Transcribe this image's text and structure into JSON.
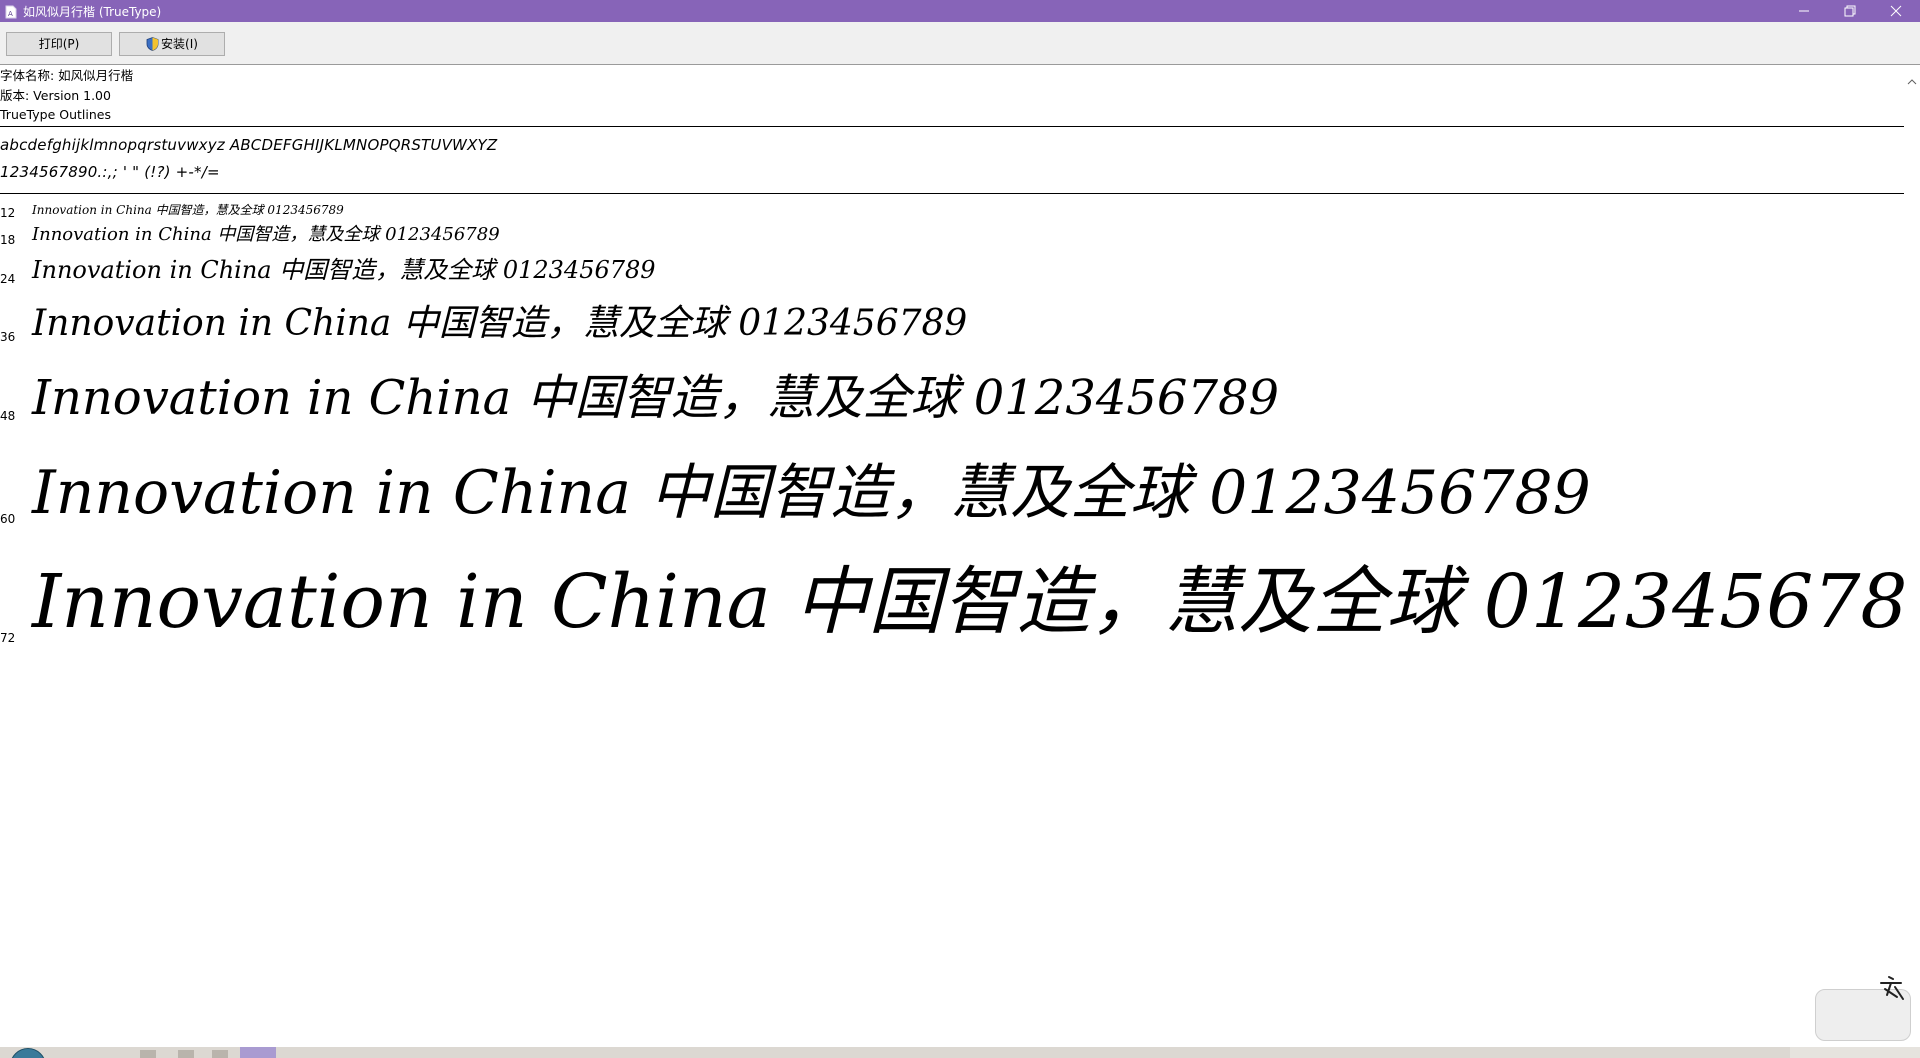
{
  "window": {
    "title": "如风似月行楷 (TrueType)",
    "colors": {
      "titlebar": "#8764b8",
      "title_text": "#ffffff"
    }
  },
  "titlebar": {
    "icons": [
      "font-file-icon",
      "minimize-icon",
      "maximize-icon",
      "close-icon"
    ]
  },
  "toolbar": {
    "print_label": "打印(P)",
    "install_label": "安装(I)",
    "install_icon": "shield-icon"
  },
  "font_info": {
    "name_line": "字体名称: 如风似月行楷",
    "version_line": "版本: Version 1.00",
    "outline_line": "TrueType Outlines"
  },
  "charset": {
    "line1": "abcdefghijklmnopqrstuvwxyz ABCDEFGHIJKLMNOPQRSTUVWXYZ",
    "line2": "1234567890.:,; ' \" (!?) +-*/="
  },
  "samples": {
    "text": "Innovation in China 中国智造，慧及全球 0123456789",
    "sizes": [
      {
        "label": "12"
      },
      {
        "label": "18"
      },
      {
        "label": "24"
      },
      {
        "label": "36"
      },
      {
        "label": "48"
      },
      {
        "label": "60"
      },
      {
        "label": "72"
      }
    ]
  }
}
